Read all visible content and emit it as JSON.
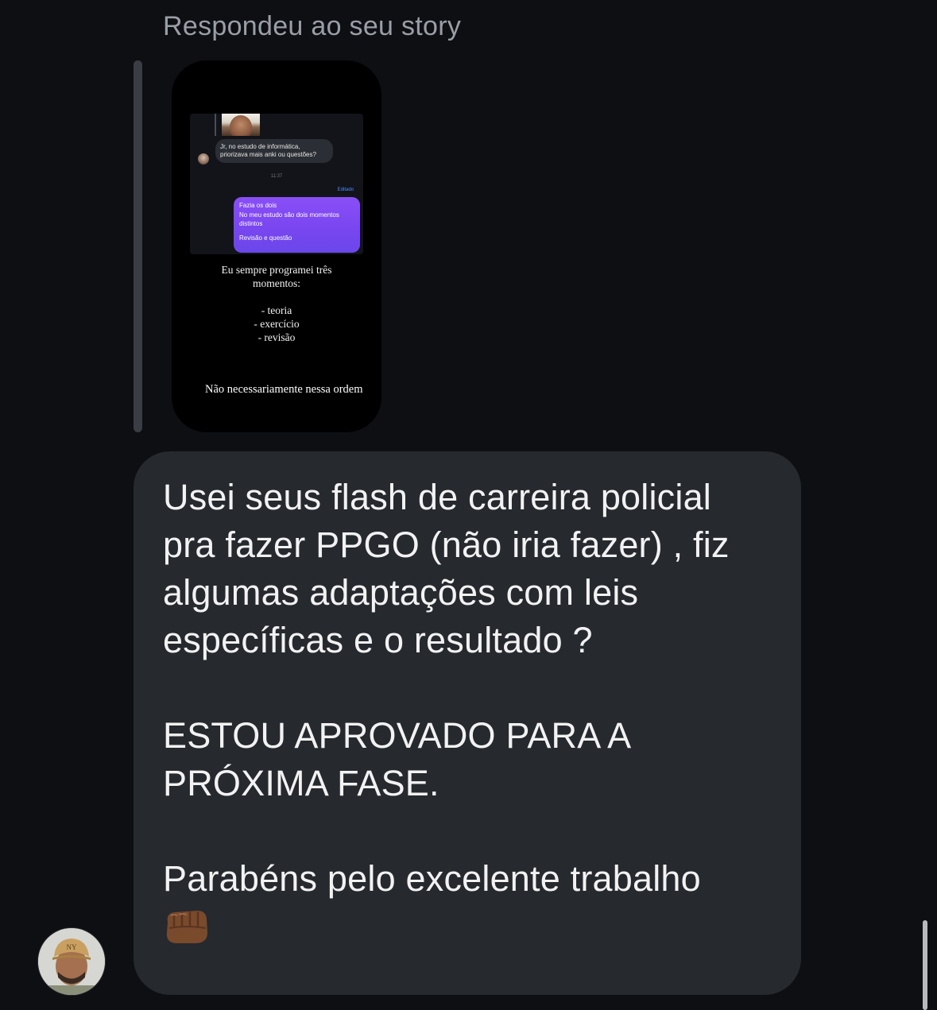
{
  "reply_caption": "Respondeu ao seu story",
  "story": {
    "incoming_message": [
      "Jr, no estudo de informática,",
      "priorizava mais anki ou questões?"
    ],
    "time": "11:37",
    "edited_label": "Editado",
    "outgoing_message": {
      "line1": "Fazia os dois",
      "line2": "No meu estudo são dois momentos",
      "line3": "distintos",
      "line4": "Revisão e questão"
    },
    "overlay_text": {
      "line1": "Eu sempre programei três",
      "line2": "momentos:",
      "item1": "- teoria",
      "item2": "- exercício",
      "item3": "- revisão"
    },
    "footer": "Não necessariamente nessa ordem"
  },
  "message": {
    "paragraph1": [
      "Usei seus flash de carreira policial",
      "pra fazer PPGO (não iria fazer) , fiz",
      "algumas adaptações com leis",
      "específicas e o resultado ?"
    ],
    "paragraph2": [
      "ESTOU APROVADO PARA A",
      "PRÓXIMA FASE."
    ],
    "paragraph3": "Parabéns pelo excelente trabalho",
    "emoji": "fist-bump-icon"
  },
  "colors": {
    "background": "#0d0f13",
    "bubble": "#26292e",
    "accent_purple": "#7a46f0",
    "edited_blue": "#4c8dff"
  }
}
